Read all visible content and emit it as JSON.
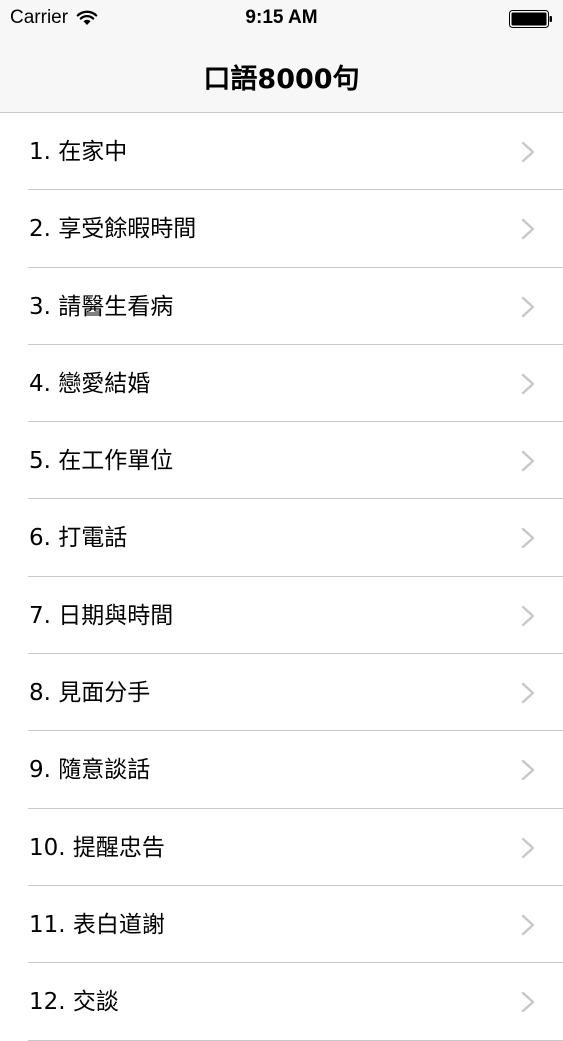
{
  "status_bar": {
    "carrier": "Carrier",
    "time": "9:15 AM"
  },
  "nav": {
    "title": "口語8000句"
  },
  "colors": {
    "separator": "#c8c7cc",
    "chevron": "#c7c7cc",
    "bar_background": "#f7f7f7"
  },
  "icons": {
    "wifi": "wifi-icon",
    "battery": "battery-icon",
    "disclosure": "chevron-right-icon"
  },
  "list": {
    "items": [
      {
        "label": "1. 在家中"
      },
      {
        "label": "2. 享受餘暇時間"
      },
      {
        "label": "3. 請醫生看病"
      },
      {
        "label": "4. 戀愛結婚"
      },
      {
        "label": "5. 在工作單位"
      },
      {
        "label": "6. 打電話"
      },
      {
        "label": "7. 日期與時間"
      },
      {
        "label": "8. 見面分手"
      },
      {
        "label": "9. 隨意談話"
      },
      {
        "label": "10. 提醒忠告"
      },
      {
        "label": "11. 表白道謝"
      },
      {
        "label": "12. 交談"
      }
    ]
  }
}
